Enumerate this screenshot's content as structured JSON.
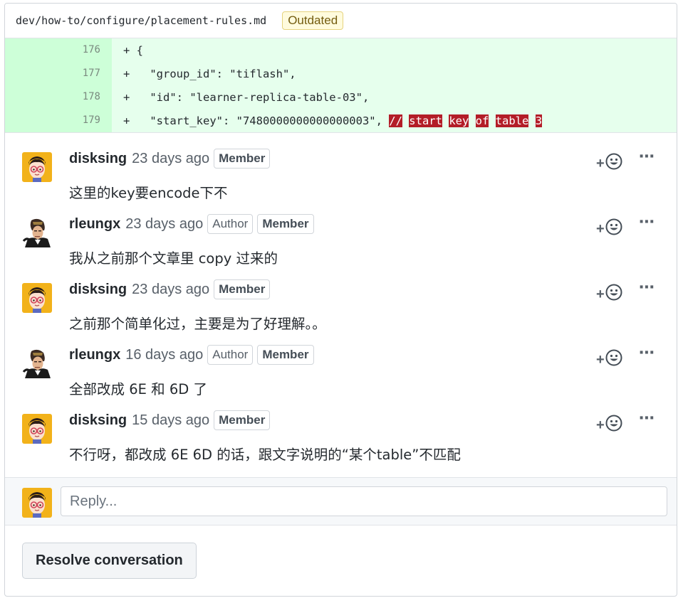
{
  "file": {
    "path": "dev/how-to/configure/placement-rules.md",
    "status_badge": "Outdated"
  },
  "diff": [
    {
      "line": "176",
      "code": "+ {"
    },
    {
      "line": "177",
      "code": "+   \"group_id\": \"tiflash\","
    },
    {
      "line": "178",
      "code": "+   \"id\": \"learner-replica-table-03\","
    },
    {
      "line": "179",
      "code": "+   \"start_key\": \"7480000000000000003\", ",
      "comment_tokens": [
        "//",
        "start",
        "key",
        "of",
        "table",
        "3"
      ]
    }
  ],
  "comments": [
    {
      "author": "disksing",
      "time": "23 days ago",
      "badges": [
        "Member"
      ],
      "body": "这里的key要encode下不",
      "avatar": "disksing"
    },
    {
      "author": "rleungx",
      "time": "23 days ago",
      "badges": [
        "Author",
        "Member"
      ],
      "body": "我从之前那个文章里 copy 过来的",
      "avatar": "rleungx"
    },
    {
      "author": "disksing",
      "time": "23 days ago",
      "badges": [
        "Member"
      ],
      "body": "之前那个简单化过，主要是为了好理解。。",
      "avatar": "disksing"
    },
    {
      "author": "rleungx",
      "time": "16 days ago",
      "badges": [
        "Author",
        "Member"
      ],
      "body": "全部改成 6E 和 6D 了",
      "avatar": "rleungx"
    },
    {
      "author": "disksing",
      "time": "15 days ago",
      "badges": [
        "Member"
      ],
      "body": "不行呀，都改成 6E 6D 的话，跟文字说明的“某个table”不匹配",
      "avatar": "disksing"
    }
  ],
  "reply": {
    "placeholder": "Reply..."
  },
  "resolve_label": "Resolve conversation",
  "icons": {
    "reaction": "add-reaction-icon",
    "more": "kebab-horizontal-icon"
  },
  "colors": {
    "added_bg": "#e6ffed",
    "added_gutter": "#cdffd8",
    "comment_highlight": "#b31d28",
    "outdated_bg": "#fffbdd"
  }
}
